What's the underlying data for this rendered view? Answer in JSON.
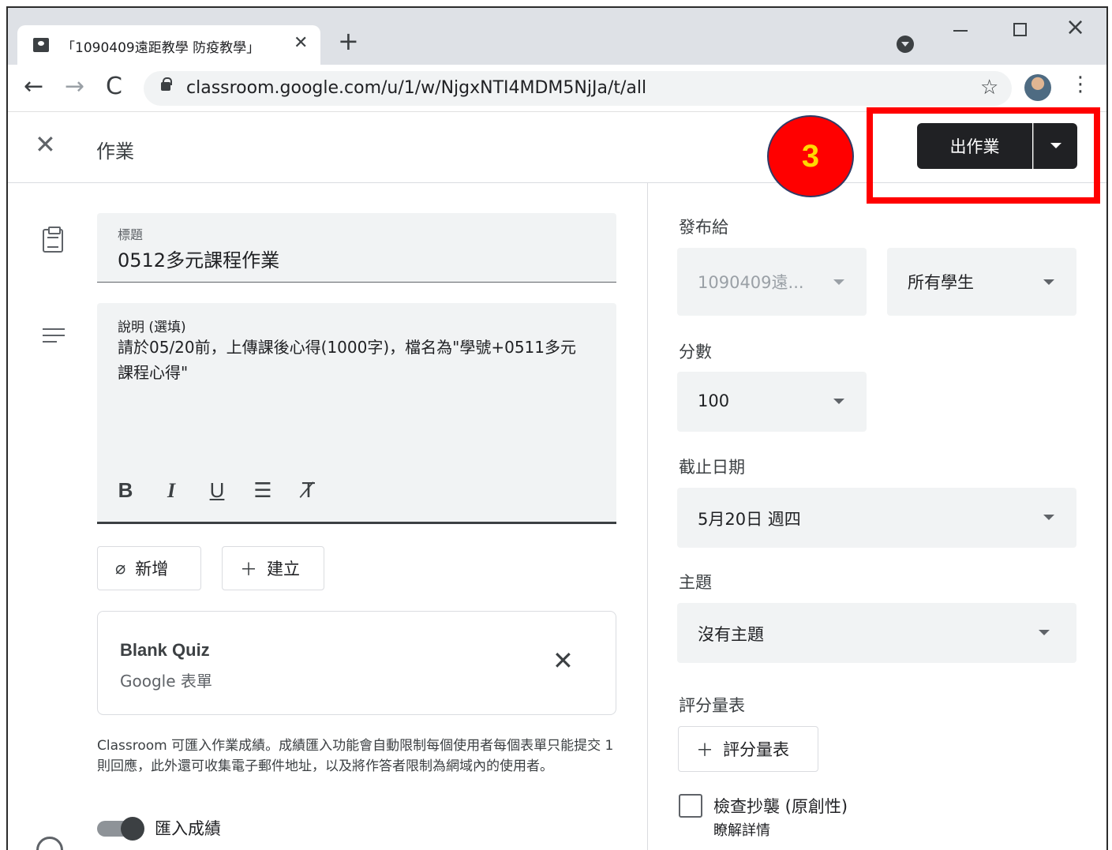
{
  "browser": {
    "tab_title": "「1090409遠距教學 防疫教學」",
    "tab_close": "✕",
    "new_tab": "+",
    "url": "classroom.google.com/u/1/w/NjgxNTI4MDM5NjJa/t/all",
    "icons": [
      "back-icon",
      "forward-icon",
      "reload-icon",
      "lock-icon",
      "star-icon",
      "menu-icon"
    ]
  },
  "header": {
    "close_symbol": "✕",
    "title": "作業",
    "step_number": "3",
    "assign_label": "出作業",
    "highlight_color": "#ff0000",
    "step_badge_color": "#ff0000",
    "step_text_color": "#ffd800"
  },
  "form": {
    "title_label": "標題",
    "title_value": "0512多元課程作業",
    "desc_label": "說明 (選填)",
    "desc_value": "請於05/20前，上傳課後心得(1000字)，檔名為\"學號+0511多元課程心得\"",
    "format": {
      "bold": "B",
      "italic": "I",
      "underline": "U",
      "list": "☰",
      "clear": "T̸"
    },
    "add_label": "新增",
    "create_label": "建立",
    "attachment": {
      "title": "Blank Quiz",
      "subtitle": "Google 表單"
    },
    "import_note": "Classroom 可匯入作業成績。成績匯入功能會自動限制每個使用者每個表單只能提交 1 則回應，此外還可收集電子郵件地址，以及將作答者限制為網域內的使用者。",
    "import_toggle_label": "匯入成績",
    "import_toggle_on": true
  },
  "settings": {
    "for_label": "發布給",
    "class_value": "1090409遠...",
    "students_value": "所有學生",
    "points_label": "分數",
    "points_value": "100",
    "due_label": "截止日期",
    "due_value": "5月20日 週四",
    "topic_label": "主題",
    "topic_value": "沒有主題",
    "rubric_label": "評分量表",
    "rubric_button": "評分量表",
    "plagiarism_label": "檢查抄襲 (原創性)",
    "learn_more": "瞭解詳情"
  }
}
